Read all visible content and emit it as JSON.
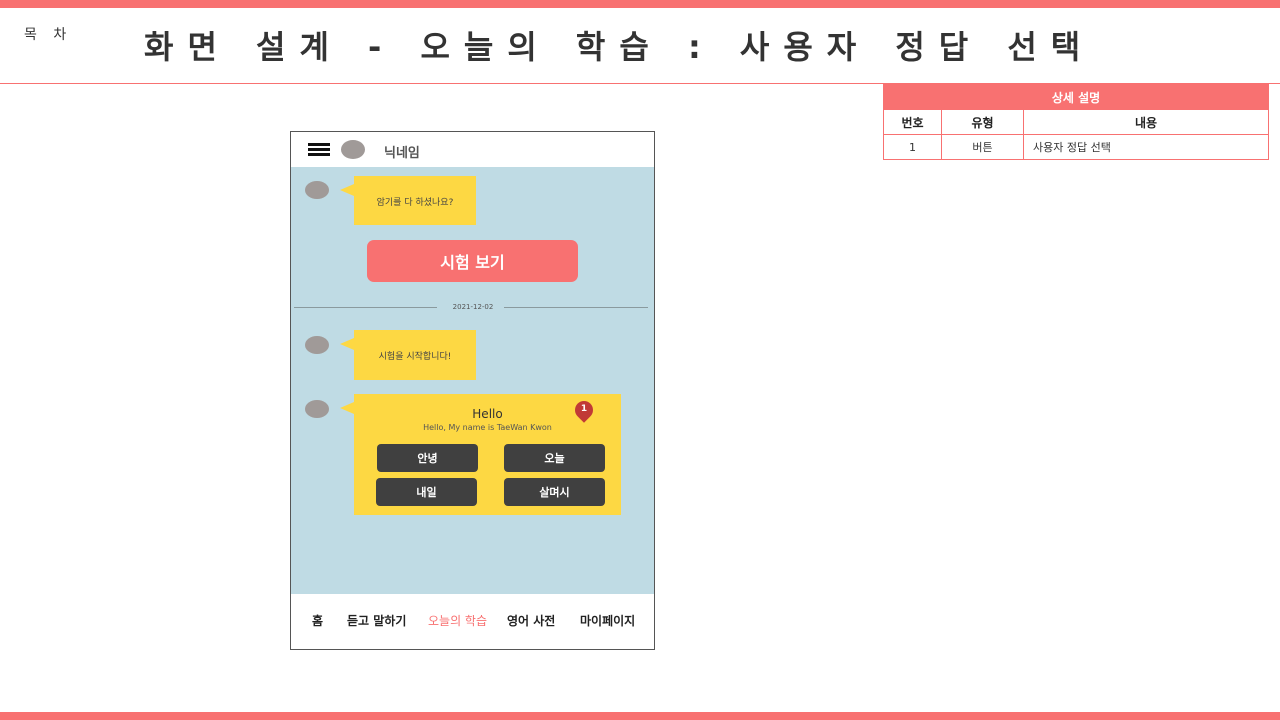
{
  "header": {
    "toc_label": "목 차",
    "title": "화면 설계 - 오늘의 학습 : 사용자 정답 선택"
  },
  "description_table": {
    "title": "상세 설명",
    "columns": [
      "번호",
      "유형",
      "내용"
    ],
    "rows": [
      {
        "no": "1",
        "type": "버튼",
        "content": "사용자 정답 선택"
      }
    ]
  },
  "phone": {
    "nickname": "닉네임",
    "chat": {
      "msg1": "암기를 다 하셨나요?",
      "exam_button": "시험 보기",
      "date": "2021-12-02",
      "msg2": "시험을 시작합니다!",
      "question": {
        "word": "Hello",
        "sentence": "Hello, My name is TaeWan Kwon",
        "options": [
          "안녕",
          "오늘",
          "내일",
          "살며시"
        ],
        "marker": "1"
      }
    },
    "nav": {
      "items": [
        "홈",
        "듣고 말하기",
        "오늘의 학습",
        "영어 사전",
        "마이페이지"
      ],
      "active": "오늘의 학습"
    }
  },
  "colors": {
    "accent": "#f87171",
    "chat_bg": "#bfdbe4",
    "bubble": "#fdd843",
    "option_button": "#404040",
    "marker": "#c13a36"
  }
}
